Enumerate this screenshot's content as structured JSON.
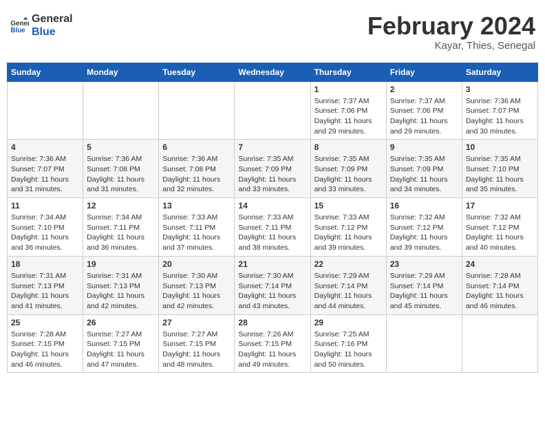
{
  "header": {
    "logo_line1": "General",
    "logo_line2": "Blue",
    "month_year": "February 2024",
    "location": "Kayar, Thies, Senegal"
  },
  "days_of_week": [
    "Sunday",
    "Monday",
    "Tuesday",
    "Wednesday",
    "Thursday",
    "Friday",
    "Saturday"
  ],
  "weeks": [
    [
      {
        "day": "",
        "info": ""
      },
      {
        "day": "",
        "info": ""
      },
      {
        "day": "",
        "info": ""
      },
      {
        "day": "",
        "info": ""
      },
      {
        "day": "1",
        "info": "Sunrise: 7:37 AM\nSunset: 7:06 PM\nDaylight: 11 hours\nand 29 minutes."
      },
      {
        "day": "2",
        "info": "Sunrise: 7:37 AM\nSunset: 7:06 PM\nDaylight: 11 hours\nand 29 minutes."
      },
      {
        "day": "3",
        "info": "Sunrise: 7:36 AM\nSunset: 7:07 PM\nDaylight: 11 hours\nand 30 minutes."
      }
    ],
    [
      {
        "day": "4",
        "info": "Sunrise: 7:36 AM\nSunset: 7:07 PM\nDaylight: 11 hours\nand 31 minutes."
      },
      {
        "day": "5",
        "info": "Sunrise: 7:36 AM\nSunset: 7:08 PM\nDaylight: 11 hours\nand 31 minutes."
      },
      {
        "day": "6",
        "info": "Sunrise: 7:36 AM\nSunset: 7:08 PM\nDaylight: 11 hours\nand 32 minutes."
      },
      {
        "day": "7",
        "info": "Sunrise: 7:35 AM\nSunset: 7:09 PM\nDaylight: 11 hours\nand 33 minutes."
      },
      {
        "day": "8",
        "info": "Sunrise: 7:35 AM\nSunset: 7:09 PM\nDaylight: 11 hours\nand 33 minutes."
      },
      {
        "day": "9",
        "info": "Sunrise: 7:35 AM\nSunset: 7:09 PM\nDaylight: 11 hours\nand 34 minutes."
      },
      {
        "day": "10",
        "info": "Sunrise: 7:35 AM\nSunset: 7:10 PM\nDaylight: 11 hours\nand 35 minutes."
      }
    ],
    [
      {
        "day": "11",
        "info": "Sunrise: 7:34 AM\nSunset: 7:10 PM\nDaylight: 11 hours\nand 36 minutes."
      },
      {
        "day": "12",
        "info": "Sunrise: 7:34 AM\nSunset: 7:11 PM\nDaylight: 11 hours\nand 36 minutes."
      },
      {
        "day": "13",
        "info": "Sunrise: 7:33 AM\nSunset: 7:11 PM\nDaylight: 11 hours\nand 37 minutes."
      },
      {
        "day": "14",
        "info": "Sunrise: 7:33 AM\nSunset: 7:11 PM\nDaylight: 11 hours\nand 38 minutes."
      },
      {
        "day": "15",
        "info": "Sunrise: 7:33 AM\nSunset: 7:12 PM\nDaylight: 11 hours\nand 39 minutes."
      },
      {
        "day": "16",
        "info": "Sunrise: 7:32 AM\nSunset: 7:12 PM\nDaylight: 11 hours\nand 39 minutes."
      },
      {
        "day": "17",
        "info": "Sunrise: 7:32 AM\nSunset: 7:12 PM\nDaylight: 11 hours\nand 40 minutes."
      }
    ],
    [
      {
        "day": "18",
        "info": "Sunrise: 7:31 AM\nSunset: 7:13 PM\nDaylight: 11 hours\nand 41 minutes."
      },
      {
        "day": "19",
        "info": "Sunrise: 7:31 AM\nSunset: 7:13 PM\nDaylight: 11 hours\nand 42 minutes."
      },
      {
        "day": "20",
        "info": "Sunrise: 7:30 AM\nSunset: 7:13 PM\nDaylight: 11 hours\nand 42 minutes."
      },
      {
        "day": "21",
        "info": "Sunrise: 7:30 AM\nSunset: 7:14 PM\nDaylight: 11 hours\nand 43 minutes."
      },
      {
        "day": "22",
        "info": "Sunrise: 7:29 AM\nSunset: 7:14 PM\nDaylight: 11 hours\nand 44 minutes."
      },
      {
        "day": "23",
        "info": "Sunrise: 7:29 AM\nSunset: 7:14 PM\nDaylight: 11 hours\nand 45 minutes."
      },
      {
        "day": "24",
        "info": "Sunrise: 7:28 AM\nSunset: 7:14 PM\nDaylight: 11 hours\nand 46 minutes."
      }
    ],
    [
      {
        "day": "25",
        "info": "Sunrise: 7:28 AM\nSunset: 7:15 PM\nDaylight: 11 hours\nand 46 minutes."
      },
      {
        "day": "26",
        "info": "Sunrise: 7:27 AM\nSunset: 7:15 PM\nDaylight: 11 hours\nand 47 minutes."
      },
      {
        "day": "27",
        "info": "Sunrise: 7:27 AM\nSunset: 7:15 PM\nDaylight: 11 hours\nand 48 minutes."
      },
      {
        "day": "28",
        "info": "Sunrise: 7:26 AM\nSunset: 7:15 PM\nDaylight: 11 hours\nand 49 minutes."
      },
      {
        "day": "29",
        "info": "Sunrise: 7:25 AM\nSunset: 7:16 PM\nDaylight: 11 hours\nand 50 minutes."
      },
      {
        "day": "",
        "info": ""
      },
      {
        "day": "",
        "info": ""
      }
    ]
  ]
}
